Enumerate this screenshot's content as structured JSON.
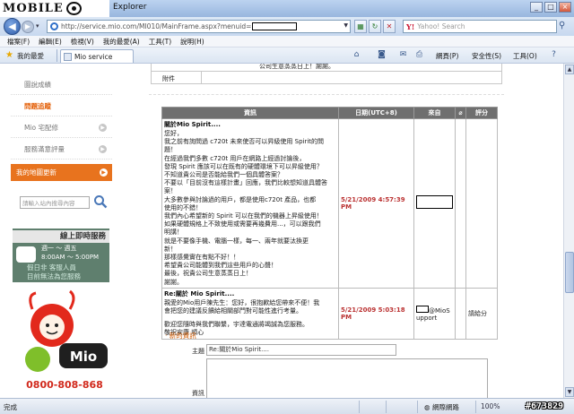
{
  "window": {
    "logo_text": "MOBILE",
    "title": "Explorer",
    "controls": [
      "_",
      "□",
      "×"
    ]
  },
  "address": {
    "url": "http://service.mio.com/MI010/MainFrame.aspx?menuid=",
    "search_placeholder": "Yahoo! Search"
  },
  "menu": [
    "檔案(F)",
    "編輯(E)",
    "檢視(V)",
    "我的最愛(A)",
    "工具(T)",
    "說明(H)"
  ],
  "favbar": {
    "favorites": "我的最愛",
    "tab": "Mio service",
    "commands": [
      "網頁(P)",
      "安全性(S)",
      "工具(O)"
    ]
  },
  "sidebar": {
    "items": [
      "圖說成績",
      "問題追蹤",
      "Mio 宅配修",
      "服務滿意評量"
    ],
    "active_index": 1,
    "highlight": "我的地圖更新",
    "search_placeholder": "請輸入站內搜尋內容",
    "service": {
      "title": "線上即時服務",
      "line1": "週一 ～ 週五",
      "line2": "8:00AM ～ 5:00PM",
      "note1": "假日非 客服人員",
      "note2": "目前無法為您服務"
    },
    "mascot_brand": "Mio",
    "hotline": "0800-808-868"
  },
  "top": {
    "reply_tail": "公司生意蒸蒸日上！謝謝。",
    "attach_label": "附件"
  },
  "table": {
    "headers": [
      "資訊",
      "日期(UTC+8)",
      "來自",
      "",
      "評分"
    ],
    "rows": [
      {
        "title": "關於Mio Spirit....",
        "lines": [
          "您好，",
          "我之前有詢問過 c720t 未來使否可以昇級使用 Spirit的問",
          "題！",
          "在經過我們多數 c720t 用戶在網路上經過討論後，",
          "發現 Spirit 應該可以在既有的硬體環境下可以昇級使用？",
          "不知道貴公司是否能給我們一個具體答案？",
          "不要以「目前沒有這樣計畫」回應，我們比較想知道具體答",
          "案！",
          "大多數參與討論過的用戶，都是使用c720t 產品，也都",
          "使用的不錯！",
          "我們內心希望新的 Spirit 可以在我們的機器上昇級使用！",
          "如果硬體規格上不致使用或需要再幾費用...，可以跟我們",
          "明講！",
          "就是不要像手機、電腦一樣，每一、兩年就要汰換更",
          "新！",
          "那樣感覺實在有點不好！！",
          "希望貴公司能體到我們這些用戶的心聲！",
          "最後，祝貴公司生意蒸蒸日上！",
          "謝謝。"
        ],
        "date": "5/21/2009 4:57:39 PM",
        "from": "",
        "rating": ""
      },
      {
        "title": "Re:關於 Mio Spirit....",
        "lines": [
          "親愛的Mio用戶陳先生：您好，很抱歉給您帶來不便！我",
          "會把您的建議反饋給相關部門對可能性進行考量。",
          "",
          "歡迎您隨時與我們聯繫，宇達電通將竭誠為您服務。",
          "敬祝安康 順心"
        ],
        "date": "5/21/2009 5:03:18 PM",
        "from": "@MioSupport",
        "rating": "請給分"
      }
    ]
  },
  "form": {
    "new_heading": "新的資訊",
    "subject_label": "主題",
    "subject_value": "Re:關於Mio Spirit....",
    "body_label": "資訊"
  },
  "status": {
    "done": "完成",
    "zone": "網際網路",
    "zoom": "100%",
    "watermark": "#673829"
  }
}
